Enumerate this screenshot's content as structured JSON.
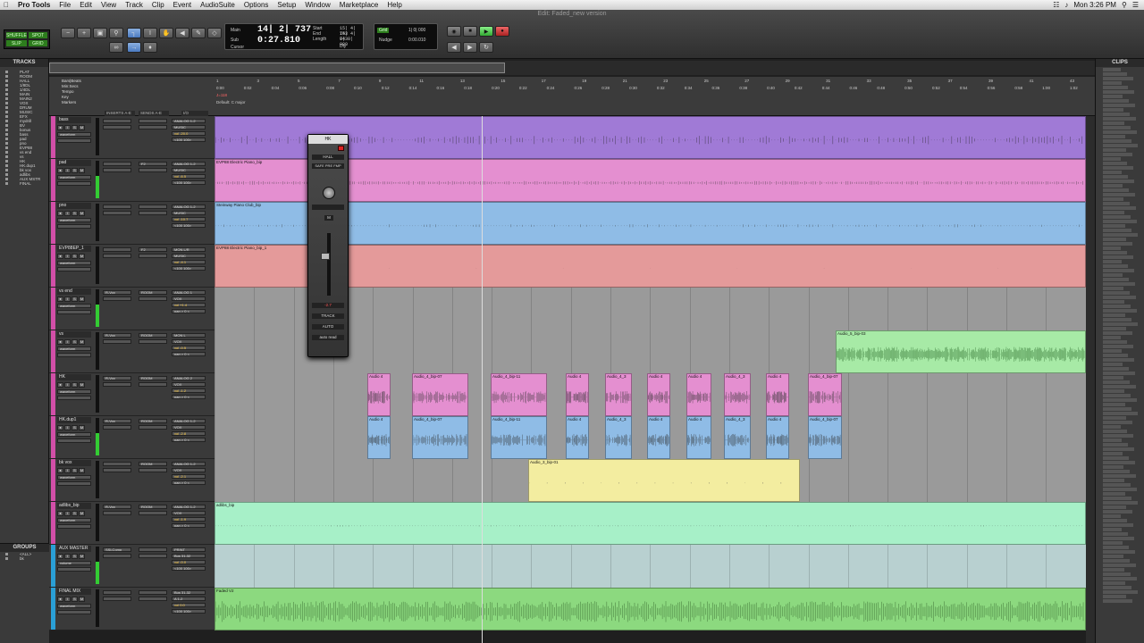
{
  "menubar": {
    "app": "Pro Tools",
    "items": [
      "File",
      "Edit",
      "View",
      "Track",
      "Clip",
      "Event",
      "AudioSuite",
      "Options",
      "Setup",
      "Window",
      "Marketplace",
      "Help"
    ],
    "clock": "Mon 3:26 PM"
  },
  "window_title": "Edit: Faded_new version",
  "modes": [
    "SHUFFLE",
    "SPOT",
    "SLIP",
    "GRID"
  ],
  "counter": {
    "main_label": "Main",
    "main_value": "14| 2| 737",
    "sub_label": "Sub",
    "sub_value": "0:27.810",
    "start_label": "Start",
    "end_label": "End",
    "length_label": "Length",
    "start_value": "15| 4| 743",
    "end_value": "15| 4| 743",
    "length_value": "0| 0| 000",
    "cursor_label": "Cursor",
    "dly_label": "Dly"
  },
  "grid": {
    "grid_label": "Grid",
    "grid_value": "1| 0| 000",
    "nudge_label": "Nudge",
    "nudge_value": "0:00.010"
  },
  "panels": {
    "tracks_title": "TRACKS",
    "groups_title": "GROUPS",
    "clips_title": "CLIPS"
  },
  "track_list": [
    "PLAT",
    "ROOM",
    "HALL",
    "1/8DL",
    "1/4DL",
    "MAIN",
    "MAIN2",
    "VOX",
    "DRUM",
    "MUSIC",
    "EFX",
    "mydrill",
    "BV",
    "bonus",
    "bass",
    "pad",
    "pno",
    "EVP88",
    "vs end",
    "vs",
    "HK",
    "HK.dup1",
    "bk vox",
    "adlibs",
    "AUX MSTR",
    "FINAL"
  ],
  "groups_list": [
    "<ALL>",
    "bk"
  ],
  "ruler": {
    "labels": [
      "Bars|Beats",
      "Min:Secs",
      "Tempo",
      "Key",
      "Markers"
    ],
    "bars": [
      "1",
      "3",
      "5",
      "7",
      "9",
      "11",
      "13",
      "15",
      "17",
      "19",
      "21",
      "23",
      "25",
      "27",
      "29",
      "31",
      "33",
      "35",
      "37",
      "39",
      "41",
      "43"
    ],
    "time": [
      "0:00",
      "0:02",
      "0:04",
      "0:06",
      "0:08",
      "0:10",
      "0:12",
      "0:14",
      "0:16",
      "0:18",
      "0:20",
      "0:22",
      "0:24",
      "0:26",
      "0:28",
      "0:30",
      "0:32",
      "0:34",
      "0:36",
      "0:38",
      "0:40",
      "0:42",
      "0:44",
      "0:46",
      "0:48",
      "0:50",
      "0:52",
      "0:54",
      "0:56",
      "0:58",
      "1:00",
      "1:02"
    ],
    "tempo": "J=118",
    "key": "Default: C major"
  },
  "columns": [
    "INSERTS A-E",
    "SENDS A-E",
    "I/O"
  ],
  "tracks": [
    {
      "name": "bass",
      "color": "#d24fa8",
      "insert": "",
      "send": "",
      "io": "ANALOG 1-2",
      "io2": "MUSIC",
      "vol": "vol -20.0",
      "pan": "<100 100>",
      "view": "waveform"
    },
    {
      "name": "pad",
      "color": "#d24fa8",
      "insert": "",
      "send": "F2",
      "io": "ANALOG 1-2",
      "io2": "MUSIC",
      "vol": "vol -6.5",
      "pan": "<100 100>",
      "view": "waveform"
    },
    {
      "name": "pno",
      "color": "#d24fa8",
      "insert": "",
      "send": "",
      "io": "ANALOG 1-2",
      "io2": "MUSIC",
      "vol": "vol -10.7",
      "pan": "<100 100>",
      "view": "waveform"
    },
    {
      "name": "EVP88EP_1",
      "color": "#d24fa8",
      "insert": "",
      "send": "F2",
      "io": "MON L/R",
      "io2": "MUSIC",
      "vol": "vol -4.1",
      "pan": "<100 100>",
      "view": "waveform"
    },
    {
      "name": "vs end",
      "color": "#d24fa8",
      "insert": "R-Vox",
      "send": "ROOM",
      "io": "ANALOG 1",
      "io2": "VOX",
      "vol": "vol +1.4",
      "pan": "pan > 0 <",
      "view": "waveform"
    },
    {
      "name": "vs",
      "color": "#d24fa8",
      "insert": "R-Vox",
      "send": "ROOM",
      "io": "MON L",
      "io2": "VOX",
      "vol": "vol -0.5",
      "pan": "pan > 0 <",
      "view": "waveform"
    },
    {
      "name": "HK",
      "color": "#d24fa8",
      "insert": "R-Vox",
      "send": "ROOM",
      "io": "ANALOG 2",
      "io2": "VOX",
      "vol": "vol -1.2",
      "pan": "pan > 0 <",
      "view": "waveform"
    },
    {
      "name": "HK.dup1",
      "color": "#d24fa8",
      "insert": "R-Vox",
      "send": "ROOM",
      "io": "ANALOG 1-2",
      "io2": "VOX",
      "vol": "vol -2.8",
      "pan": "pan > 0 <",
      "view": "waveform"
    },
    {
      "name": "bk vox",
      "color": "#d24fa8",
      "insert": "",
      "send": "ROOM",
      "io": "ANALOG 1-2",
      "io2": "VOX",
      "vol": "vol -2.1",
      "pan": "pan > 0 <",
      "view": "waveform"
    },
    {
      "name": "adlibs_bip",
      "color": "#d24fa8",
      "insert": "R-Vox",
      "send": "ROOM",
      "io": "ANALOG 1-2",
      "io2": "VOX",
      "vol": "vol -1.9",
      "pan": "pan > 0 <",
      "view": "waveform"
    },
    {
      "name": "AUX MASTER",
      "color": "#2a9fd6",
      "insert": "SSLComp",
      "send": "",
      "io": "PRINT",
      "io2": "Bus 31-32",
      "vol": "vol -0.0",
      "pan": "<100 100>",
      "view": "volume"
    },
    {
      "name": "FINAL MIX",
      "color": "#2a9fd6",
      "insert": "",
      "send": "",
      "io": "Bus 31-32",
      "io2": "A 1-2",
      "vol": "vol 0.0",
      "pan": "<100 100>",
      "view": "waveform"
    }
  ],
  "clip_names": {
    "clip_top": "",
    "evp_electric": "EVP88 Electric Piano_bip",
    "steinway": "Steinway Piano Club_bip",
    "evp_electric_1": "EVP88 Electric Piano_bip_1",
    "audio5": "Audio_5_bip-03",
    "audio4_07": "Audio_4_bip-07",
    "audio4_11": "Audio_4_bip-11",
    "audio4_x": "Audio 4",
    "audio4_short": "Audio_4_3",
    "audio3": "Audio_3_bip-01",
    "adlibs": "adlibs_bip",
    "faded": "Faded V2"
  },
  "floating": {
    "title": "HK",
    "track": "HK",
    "ins": "HALL",
    "safe_pre_fmp": "SAFE  PRE  FMP",
    "val": "-2.7",
    "label": "TRACK",
    "auto": "AUTO",
    "auto_mode": "auto read"
  },
  "colors": {
    "purple": "#a07ad6",
    "pink": "#e48fd0",
    "blue": "#8fbce6",
    "salmon": "#e49a9a",
    "green": "#a7eaa6",
    "yellow": "#f3eda0",
    "mint": "#a7f0c8",
    "teal": "#b8d0d0",
    "final_green": "#8cd97f"
  }
}
